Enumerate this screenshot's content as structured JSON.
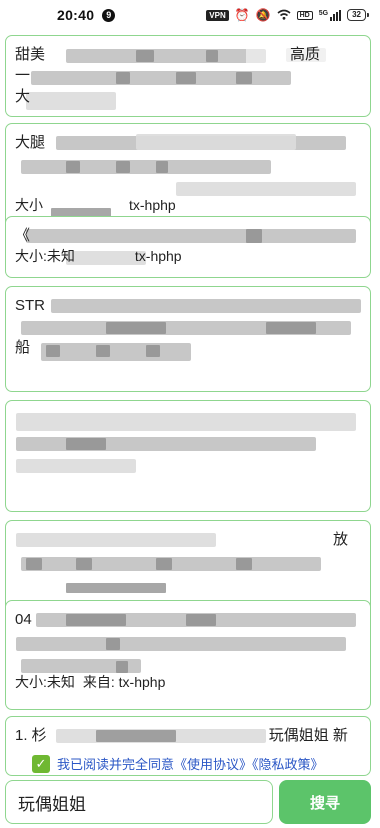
{
  "status_bar": {
    "time": "20:40",
    "notification_badge": "9",
    "vpn_label": "VPN",
    "hd_label": "HD",
    "network_label": "5G",
    "battery_level": "32"
  },
  "results": [
    {
      "title_start": "甜美",
      "title_end": "高质",
      "line2": "一",
      "line3": "大"
    },
    {
      "title_start": "大腿",
      "title_end": "",
      "meta_size": "大小",
      "meta_source": "tx-hphp"
    },
    {
      "title_start": "《",
      "meta_size": "大小:未知",
      "meta_source": "tx-hphp"
    },
    {
      "title_start": "STR",
      "line3": "船"
    },
    {
      "title_start": "",
      "meta_size": ""
    },
    {
      "title_start": "",
      "title_end": "放",
      "line2": "",
      "meta_size": ""
    },
    {
      "title_start": "04",
      "meta_size": "大小:未知",
      "meta_source": "来自:  tx-hphp"
    },
    {
      "title_start": "1. 杉",
      "title_end": "玩偶姐姐  新"
    }
  ],
  "agreement": {
    "checked": true,
    "text": "我已阅读并完全同意《使用协议》《隐私政策》"
  },
  "search": {
    "value": "玩偶姐姐",
    "button_label": "搜寻"
  },
  "colors": {
    "card_border": "#8fd68f",
    "button_green": "#5cc46a",
    "checkbox_green": "#6fb832",
    "link_blue": "#2b57c6"
  }
}
